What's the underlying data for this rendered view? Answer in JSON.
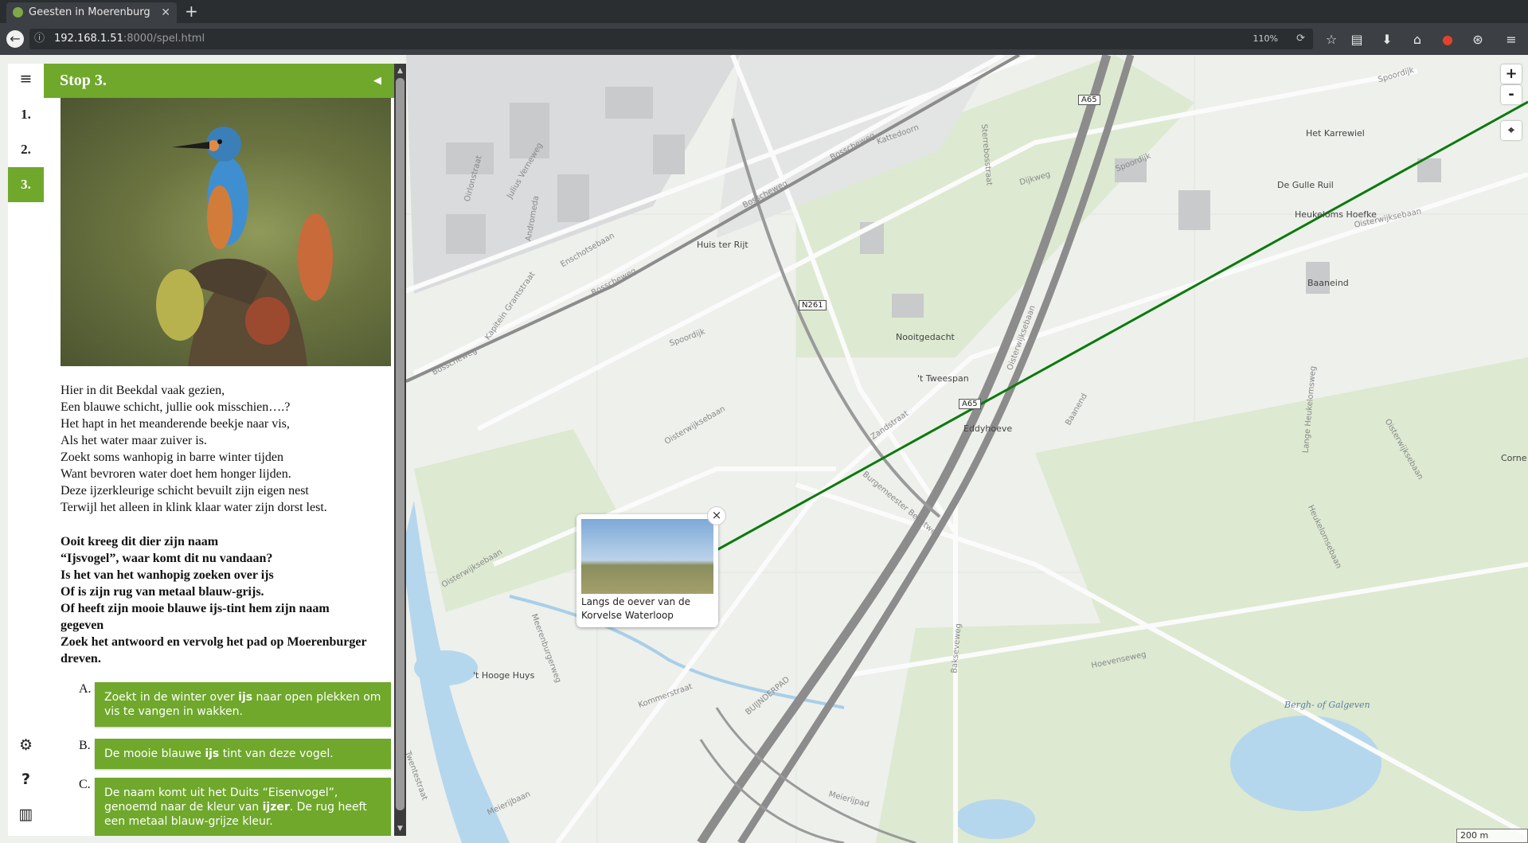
{
  "browser": {
    "tab_title": "Geesten in Moerenburg",
    "tab_close": "✕",
    "new_tab": "+",
    "url_host": "192.168.1.51",
    "url_rest": ":8000/spel.html",
    "zoom": "110%"
  },
  "sidebar": {
    "menu_icon": "hamburger-icon",
    "stops": [
      "1.",
      "2.",
      "3."
    ],
    "active_stop": "3.",
    "bottom_icons": [
      "gear-icon",
      "question-icon",
      "map-icon"
    ]
  },
  "panel": {
    "title": "Stop 3.",
    "image_alt": "ijsvogel",
    "poem": [
      "Hier in dit Beekdal vaak gezien,",
      "Een blauwe schicht, jullie ook misschien….?",
      "Het hapt in het meanderende beekje naar vis,",
      "Als het water maar zuiver is.",
      "Zoekt soms wanhopig in barre winter tijden",
      "Want bevroren water doet hem honger lijden.",
      "Deze ijzerkleurige schicht bevuilt zijn eigen nest",
      "Terwijl het alleen in klink klaar water zijn dorst lest."
    ],
    "question": [
      "Ooit kreeg dit dier zijn naam",
      "“Ijsvogel”, waar komt dit nu vandaan?",
      "Is het van het wanhopig zoeken over ijs",
      "Of is zijn rug van metaal blauw-grijs.",
      "Of heeft zijn mooie blauwe ijs-tint hem zijn naam gegeven",
      "Zoek het antwoord en vervolg het pad op Moerenburger dreven."
    ],
    "options": [
      {
        "letter": "A.",
        "pre": "Zoekt in de winter over ",
        "bold": "ijs",
        "post": " naar open plekken om vis te vangen in wakken."
      },
      {
        "letter": "B.",
        "pre": "De mooie blauwe ",
        "bold": "ijs",
        "post": " tint van deze vogel."
      },
      {
        "letter": "C.",
        "pre": "De naam komt uit het Duits “Eisenvogel”, genoemd naar de kleur van ",
        "bold": "ijzer",
        "post": ". De rug heeft een metaal blauw-grijze kleur."
      }
    ]
  },
  "map": {
    "popup_caption": "Langs de oever van de Korvelse Waterloop",
    "popup_close": "×",
    "zoom_in": "+",
    "zoom_out": "-",
    "locate_icon": "location-pin-icon",
    "scale": "200 m",
    "place_labels": [
      "Huis ter Rijt",
      "Nooitgedacht",
      "'t Tweespan",
      "Eddyhoeve",
      "Het Karrewiel",
      "De Gulle Ruil",
      "Heukeloms Hoefke",
      "Baaneind",
      "'t Hooge Huys",
      "Bergh- of Galgeven",
      "Corne"
    ],
    "road_labels": [
      "Bosscheweg",
      "Bosscheweg",
      "Bosscheweg",
      "Bosscheweg",
      "Spoordijk",
      "Spoordijk",
      "Spoordijk",
      "Dijkweg",
      "Oisterwijksebaan",
      "Oisterwijksebaan",
      "Oisterwijksebaan",
      "Oisterwijksebaan",
      "Oisterwijksebaan",
      "Enschotsebaan",
      "Kapitein Grantstraat",
      "Oirlonstraat",
      "Julius Verneweg",
      "Andromeda",
      "Kattedoorn",
      "Sterrebosstraat",
      "Zandstraat",
      "Burgemeester Bechtweg",
      "Baanend",
      "Meerenburgerweg",
      "Kommerstraat",
      "Bakseveweg",
      "Hoevenseweg",
      "BUIJNDERPAD",
      "Meierijpad",
      "Meierijbaan",
      "Twentestraat",
      "Lange Heukelomsweg",
      "Heukelomsebaan"
    ],
    "shields": [
      "A65",
      "N261",
      "A65"
    ]
  }
}
